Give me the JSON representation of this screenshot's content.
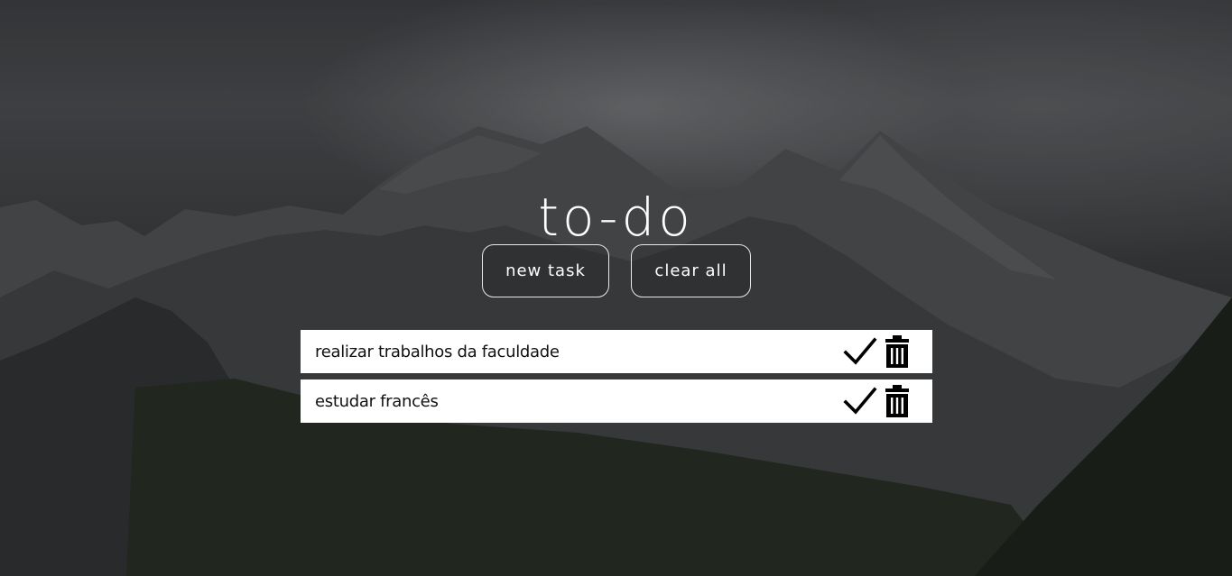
{
  "app": {
    "title": "to-do"
  },
  "toolbar": {
    "new_task_label": "new task",
    "clear_all_label": "clear all"
  },
  "tasks": [
    {
      "label": "realizar trabalhos da faculdade",
      "complete_icon": "check-icon",
      "delete_icon": "trash-icon"
    },
    {
      "label": "estudar francês",
      "complete_icon": "check-icon",
      "delete_icon": "trash-icon"
    }
  ],
  "colors": {
    "text_on_background": "#ffffff",
    "task_background": "#ffffff",
    "task_text": "#111111",
    "icon": "#000000"
  }
}
